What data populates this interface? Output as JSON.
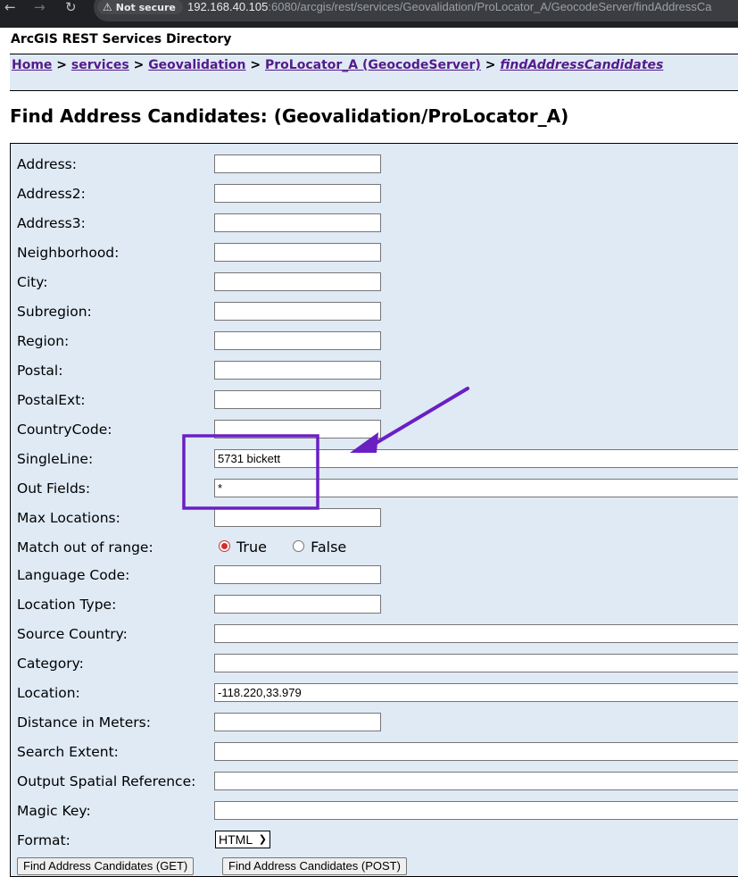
{
  "browser": {
    "back_icon": "back-arrow-icon",
    "forward_icon": "forward-arrow-icon",
    "reload_icon": "reload-icon",
    "security_label": "Not secure",
    "url_host": "192.168.40.105",
    "url_rest": ":6080/arcgis/rest/services/Geovalidation/ProLocator_A/GeocodeServer/findAddressCa"
  },
  "directory_title": "ArcGIS REST Services Directory",
  "breadcrumb": {
    "home": "Home",
    "services": "services",
    "folder": "Geovalidation",
    "service": "ProLocator_A (GeocodeServer)",
    "operation": "findAddressCandidates",
    "separator": ">"
  },
  "page_title": "Find Address Candidates: (Geovalidation/ProLocator_A)",
  "form": {
    "fields": [
      {
        "label": "Address:",
        "value": ""
      },
      {
        "label": "Address2:",
        "value": ""
      },
      {
        "label": "Address3:",
        "value": ""
      },
      {
        "label": "Neighborhood:",
        "value": ""
      },
      {
        "label": "City:",
        "value": ""
      },
      {
        "label": "Subregion:",
        "value": ""
      },
      {
        "label": "Region:",
        "value": ""
      },
      {
        "label": "Postal:",
        "value": ""
      },
      {
        "label": "PostalExt:",
        "value": ""
      },
      {
        "label": "CountryCode:",
        "value": ""
      },
      {
        "label": "SingleLine:",
        "value": "5731 bickett"
      },
      {
        "label": "Out Fields:",
        "value": "*"
      },
      {
        "label": "Max Locations:",
        "value": ""
      },
      {
        "label": "Match out of range:",
        "value": ""
      },
      {
        "label": "Language Code:",
        "value": ""
      },
      {
        "label": "Location Type:",
        "value": ""
      },
      {
        "label": "Source Country:",
        "value": ""
      },
      {
        "label": "Category:",
        "value": ""
      },
      {
        "label": "Location:",
        "value": "-118.220,33.979"
      },
      {
        "label": "Distance in Meters:",
        "value": ""
      },
      {
        "label": "Search Extent:",
        "value": ""
      },
      {
        "label": "Output Spatial Reference:",
        "value": ""
      },
      {
        "label": "Magic Key:",
        "value": ""
      },
      {
        "label": "Format:",
        "value": ""
      }
    ],
    "match_out_of_range": {
      "true_label": "True",
      "false_label": "False",
      "selected": "True"
    },
    "format_selected": "HTML",
    "buttons": {
      "get": "Find Address Candidates (GET)",
      "post": "Find Address Candidates (POST)"
    }
  },
  "annotation": {
    "color": "#6a1fc4"
  }
}
